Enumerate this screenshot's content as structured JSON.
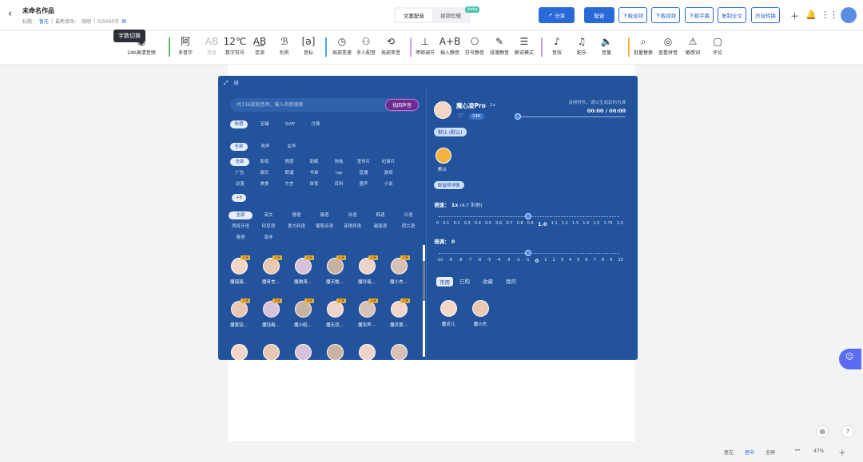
{
  "app": {
    "title": "未命名作品",
    "doc_label": "标题：",
    "doc_value": "暂无",
    "last_modified_label": "最新修改：",
    "last_modified_value": "刚刚",
    "word_count": "0/5000字"
  },
  "mode_tabs": [
    {
      "label": "文案配音"
    },
    {
      "label": "视频剪辑"
    }
  ],
  "mode_badge": "beta",
  "header_buttons": {
    "share": "分享",
    "dub": "配音",
    "download_audio": "下载音频",
    "download_video": "下载视频",
    "download_subtitle": "下载字幕",
    "copy_all": "复制全文",
    "voice_convert": "声音转换"
  },
  "tooltip": "字数切换",
  "toolbar": [
    {
      "label": "24K高清音频",
      "icon": "hd-icon"
    },
    {
      "label": "多音字",
      "icon": "polyphone-icon"
    },
    {
      "label": "英音",
      "icon": "english-icon",
      "disabled": true
    },
    {
      "label": "数字符号",
      "icon": "number-icon"
    },
    {
      "label": "连读",
      "icon": "liaison-icon"
    },
    {
      "label": "别名",
      "icon": "alias-icon"
    },
    {
      "label": "音标",
      "icon": "phonetic-icon"
    },
    {
      "label": "局部变速",
      "icon": "speed-icon"
    },
    {
      "label": "多人配音",
      "icon": "multi-voice-icon"
    },
    {
      "label": "局部变音",
      "icon": "voice-change-icon"
    },
    {
      "label": "停顿调节",
      "icon": "pause-icon"
    },
    {
      "label": "插入静音",
      "icon": "silence-icon"
    },
    {
      "label": "符号静音",
      "icon": "symbol-silence-icon"
    },
    {
      "label": "段落静音",
      "icon": "paragraph-silence-icon"
    },
    {
      "label": "解说模式",
      "icon": "narration-icon"
    },
    {
      "label": "音效",
      "icon": "sfx-icon"
    },
    {
      "label": "配乐",
      "icon": "music-icon"
    },
    {
      "label": "音量",
      "icon": "volume-icon"
    },
    {
      "label": "批量替换",
      "icon": "replace-icon"
    },
    {
      "label": "查看拼音",
      "icon": "pinyin-icon"
    },
    {
      "label": "敏感词",
      "icon": "sensitive-icon"
    },
    {
      "label": "评论",
      "icon": "comment-icon"
    }
  ],
  "panel": {
    "search_placeholder": "共736款配音师，输入名称搜索",
    "find_button": "找回声音",
    "tabs": [
      "热榜",
      "至臻",
      "SVIP",
      "付费"
    ],
    "gender": [
      "全部",
      "男声",
      "女声"
    ],
    "categories": [
      "全部",
      "影视",
      "情感",
      "助眠",
      "快板",
      "宣传片",
      "纪录片",
      "广告",
      "娱乐",
      "朗诵",
      "书单",
      "rap",
      "直播",
      "游戏",
      "动漫",
      "美食",
      "方言",
      "体育",
      "百科",
      "童声",
      "小说"
    ],
    "more_categories": "+6",
    "languages": [
      "全部",
      "英文",
      "德语",
      "俄语",
      "法语",
      "韩语",
      "日语",
      "西班牙语",
      "印尼语",
      "意大利语",
      "葡萄牙语",
      "菲律宾语",
      "越南语",
      "荷兰语",
      "泰语",
      "南非"
    ],
    "voices": [
      "魔瑶瑶...",
      "魔青言...",
      "魔驰涛...",
      "魔天勉...",
      "魔玲瑶...",
      "魔小杰...",
      "魔黄钰...",
      "魔钰梅...",
      "魔小昭...",
      "魔无忌...",
      "魔农声...",
      "魔灵景..."
    ],
    "voice_tag": "至臻",
    "current_voice": {
      "name": "魔心凌Pro",
      "speed_tag": "1x",
      "quality": "24K",
      "style_button": "默认 (默认)",
      "style_name": "默认",
      "detail_button": "配音师详情"
    },
    "preview_hint": "音频时长，请以生成后的为准",
    "time": "00:00 / 00:00",
    "speed_label": "语速：",
    "speed_value": "1x",
    "speed_unit": "(4.7 字/秒)",
    "speed_ticks": [
      "0",
      "0.1",
      "0.2",
      "0.3",
      "0.4",
      "0.5",
      "0.6",
      "0.7",
      "0.8",
      "0.9",
      "1.0",
      "1.1",
      "1.2",
      "1.3",
      "1.4",
      "1.5",
      "1.75",
      "2.0"
    ],
    "pitch_label": "语调：",
    "pitch_value": "0",
    "pitch_ticks": [
      "-10",
      "-9",
      "-8",
      "-7",
      "-6",
      "-5",
      "-4",
      "-3",
      "-2",
      "-1",
      "0",
      "1",
      "2",
      "3",
      "4",
      "5",
      "6",
      "7",
      "8",
      "9",
      "10"
    ],
    "recent_tabs": [
      "常用",
      "已购",
      "收藏",
      "我的"
    ],
    "recent_voices": [
      "魔灵儿",
      "魔小杰"
    ]
  },
  "bottom": {
    "left": "居左",
    "center": "居中",
    "full": "全屏",
    "zoom": "47%"
  }
}
